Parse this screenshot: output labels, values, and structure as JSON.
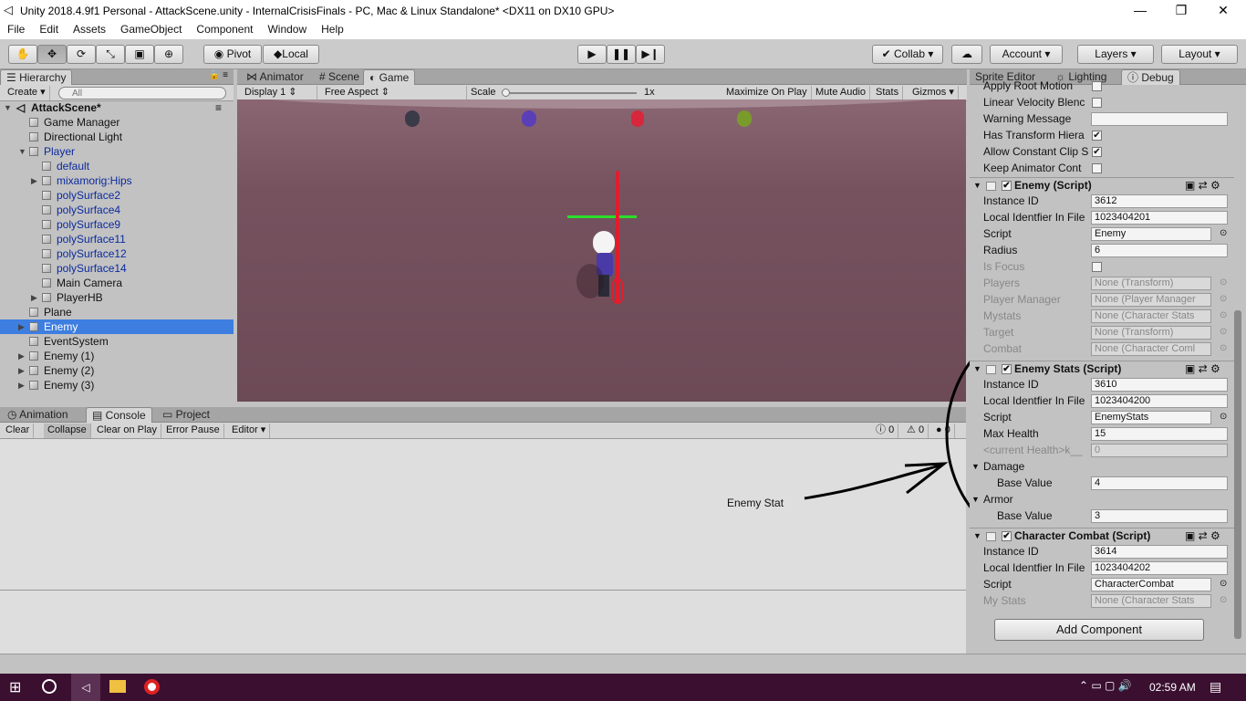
{
  "window": {
    "title": "Unity 2018.4.9f1 Personal - AttackScene.unity - InternalCrisisFinals - PC, Mac & Linux Standalone* <DX11 on DX10 GPU>"
  },
  "menu": [
    "File",
    "Edit",
    "Assets",
    "GameObject",
    "Component",
    "Window",
    "Help"
  ],
  "toolbar": {
    "pivot": "Pivot",
    "local": "Local",
    "collab": "Collab",
    "account": "Account",
    "layers": "Layers",
    "layout": "Layout"
  },
  "hierarchy": {
    "tab": "Hierarchy",
    "create": "Create",
    "search_placeholder": "All",
    "scene": "AttackScene*",
    "items": [
      {
        "label": "Game Manager",
        "indent": 1,
        "arrow": false,
        "blue": false
      },
      {
        "label": "Directional Light",
        "indent": 1,
        "arrow": false,
        "blue": false
      },
      {
        "label": "Player",
        "indent": 1,
        "arrow": "open",
        "blue": true
      },
      {
        "label": "default",
        "indent": 2,
        "arrow": false,
        "blue": true
      },
      {
        "label": "mixamorig:Hips",
        "indent": 2,
        "arrow": "closed",
        "blue": true
      },
      {
        "label": "polySurface2",
        "indent": 2,
        "arrow": false,
        "blue": true
      },
      {
        "label": "polySurface4",
        "indent": 2,
        "arrow": false,
        "blue": true
      },
      {
        "label": "polySurface9",
        "indent": 2,
        "arrow": false,
        "blue": true
      },
      {
        "label": "polySurface11",
        "indent": 2,
        "arrow": false,
        "blue": true
      },
      {
        "label": "polySurface12",
        "indent": 2,
        "arrow": false,
        "blue": true
      },
      {
        "label": "polySurface14",
        "indent": 2,
        "arrow": false,
        "blue": true
      },
      {
        "label": "Main Camera",
        "indent": 2,
        "arrow": false,
        "blue": false
      },
      {
        "label": "PlayerHB",
        "indent": 2,
        "arrow": "closed",
        "blue": false
      },
      {
        "label": "Plane",
        "indent": 1,
        "arrow": false,
        "blue": false
      },
      {
        "label": "Enemy",
        "indent": 1,
        "arrow": "closed",
        "blue": false,
        "selected": true
      },
      {
        "label": "EventSystem",
        "indent": 1,
        "arrow": false,
        "blue": false
      },
      {
        "label": "Enemy (1)",
        "indent": 1,
        "arrow": "closed",
        "blue": false
      },
      {
        "label": "Enemy (2)",
        "indent": 1,
        "arrow": "closed",
        "blue": false
      },
      {
        "label": "Enemy (3)",
        "indent": 1,
        "arrow": "closed",
        "blue": false
      }
    ]
  },
  "center_tabs": {
    "animator": "Animator",
    "scene": "Scene",
    "game": "Game"
  },
  "game_bar": {
    "display": "Display 1",
    "aspect": "Free Aspect",
    "scale_label": "Scale",
    "scale_value": "1x",
    "maximize": "Maximize On Play",
    "mute": "Mute Audio",
    "stats": "Stats",
    "gizmos": "Gizmos"
  },
  "bottom_tabs": {
    "animation": "Animation",
    "console": "Console",
    "project": "Project"
  },
  "console_bar": {
    "clear": "Clear",
    "collapse": "Collapse",
    "clear_on_play": "Clear on Play",
    "error_pause": "Error Pause",
    "editor": "Editor",
    "count_log": "0",
    "count_warn": "0",
    "count_err": "0"
  },
  "annotation": {
    "text": "Enemy Stat"
  },
  "inspector": {
    "tabs": {
      "sprite_editor": "Sprite Editor",
      "lighting": "Lighting",
      "debug": "Debug"
    },
    "top_rows": [
      {
        "label": "Apply Root Motion",
        "checked": false
      },
      {
        "label": "Linear Velocity Blenc",
        "checked": false
      },
      {
        "label": "Warning Message",
        "field": ""
      },
      {
        "label": "Has Transform Hiera",
        "checked": true
      },
      {
        "label": "Allow Constant Clip S",
        "checked": true
      },
      {
        "label": "Keep Animator Cont",
        "checked": false
      }
    ],
    "enemy": {
      "title": "Enemy (Script)",
      "instance_id_label": "Instance ID",
      "instance_id": "3612",
      "local_id_label": "Local Identfier In File",
      "local_id": "1023404201",
      "script_label": "Script",
      "script": "Enemy",
      "radius_label": "Radius",
      "radius": "6",
      "is_focus_label": "Is Focus",
      "players_label": "Players",
      "players": "None (Transform)",
      "player_manager_label": "Player Manager",
      "player_manager": "None (Player Manager",
      "mystats_label": "Mystats",
      "mystats": "None (Character Stats",
      "target_label": "Target",
      "target": "None (Transform)",
      "combat_label": "Combat",
      "combat": "None (Character Coml"
    },
    "enemy_stats": {
      "title": "Enemy Stats (Script)",
      "instance_id_label": "Instance ID",
      "instance_id": "3610",
      "local_id_label": "Local Identfier In File",
      "local_id": "1023404200",
      "script_label": "Script",
      "script": "EnemyStats",
      "max_health_label": "Max Health",
      "max_health": "15",
      "current_health_label": "<current Health>k__",
      "current_health": "0",
      "damage_label": "Damage",
      "base_value_label": "Base Value",
      "damage_base": "4",
      "armor_label": "Armor",
      "armor_base": "3"
    },
    "character_combat": {
      "title": "Character Combat (Script)",
      "instance_id_label": "Instance ID",
      "instance_id": "3614",
      "local_id_label": "Local Identfier In File",
      "local_id": "1023404202",
      "script_label": "Script",
      "script": "CharacterCombat",
      "my_stats_label": "My Stats",
      "my_stats": "None (Character Stats"
    },
    "add_component": "Add Component"
  },
  "taskbar": {
    "time": "02:59 AM"
  },
  "colors": {
    "selection": "#3d7ee0",
    "taskbar": "#3a0f30",
    "viewport": "#76525f"
  }
}
